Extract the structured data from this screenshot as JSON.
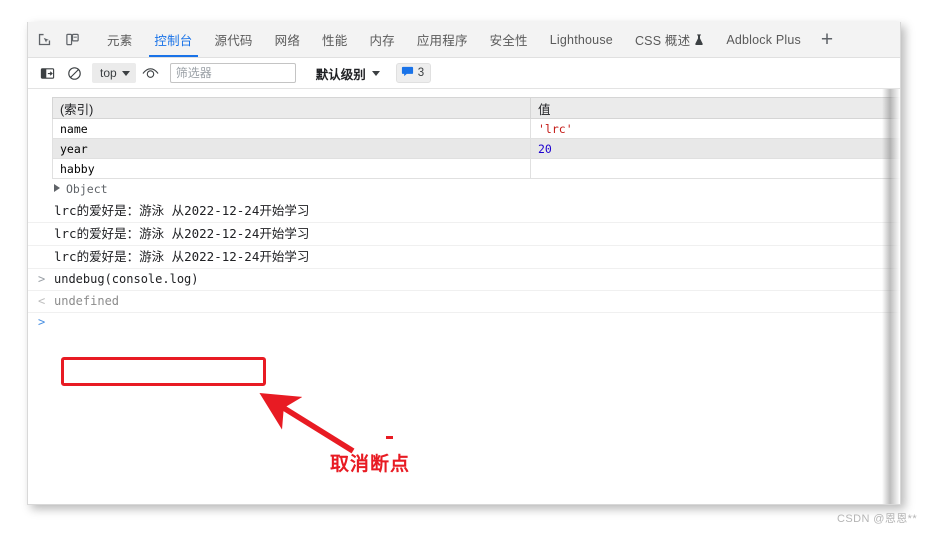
{
  "tabbar": {
    "inspect_icon": "inspect-element-icon",
    "device_icon": "device-toolbar-icon",
    "tabs": [
      {
        "label": "元素",
        "active": false
      },
      {
        "label": "控制台",
        "active": true
      },
      {
        "label": "源代码",
        "active": false
      },
      {
        "label": "网络",
        "active": false
      },
      {
        "label": "性能",
        "active": false
      },
      {
        "label": "内存",
        "active": false
      },
      {
        "label": "应用程序",
        "active": false
      },
      {
        "label": "安全性",
        "active": false
      },
      {
        "label": "Lighthouse",
        "active": false
      },
      {
        "label": "CSS 概述",
        "active": false,
        "icon": "flask-icon"
      },
      {
        "label": "Adblock Plus",
        "active": false
      }
    ],
    "add_tab_label": "+",
    "active_color": "#1a73e8"
  },
  "toolbar": {
    "sidebar_icon": "show-console-sidebar-icon",
    "clear_icon": "clear-console-icon",
    "context_value": "top",
    "eye_icon": "live-expression-icon",
    "filter_placeholder": "筛选器",
    "filter_value": "",
    "level_label": "默认级别",
    "message_count": "3",
    "message_icon": "speech-bubble-icon",
    "badge_color": "#1a73e8"
  },
  "console": {
    "table": {
      "columns": [
        "(索引)",
        "值"
      ],
      "rows": [
        {
          "key": "name",
          "value": "'lrc'",
          "type": "string"
        },
        {
          "key": "year",
          "value": "20",
          "type": "number"
        },
        {
          "key": "habby",
          "value": "",
          "type": "empty"
        }
      ]
    },
    "object_row": {
      "label": "Object",
      "expander": "disclosure-triangle-icon"
    },
    "log_lines": [
      "lrc的爱好是：游泳 从2022-12-24开始学习",
      "lrc的爱好是：游泳 从2022-12-24开始学习",
      "lrc的爱好是：游泳 从2022-12-24开始学习"
    ],
    "input_prompt": ">",
    "input_command": "undebug(console.log)",
    "result_prompt": "<",
    "result_value": "undefined",
    "empty_prompt": ">"
  },
  "annotation": {
    "text": "取消断点",
    "color": "#e81b23"
  },
  "watermark": {
    "text": "CSDN @恩恩**"
  }
}
